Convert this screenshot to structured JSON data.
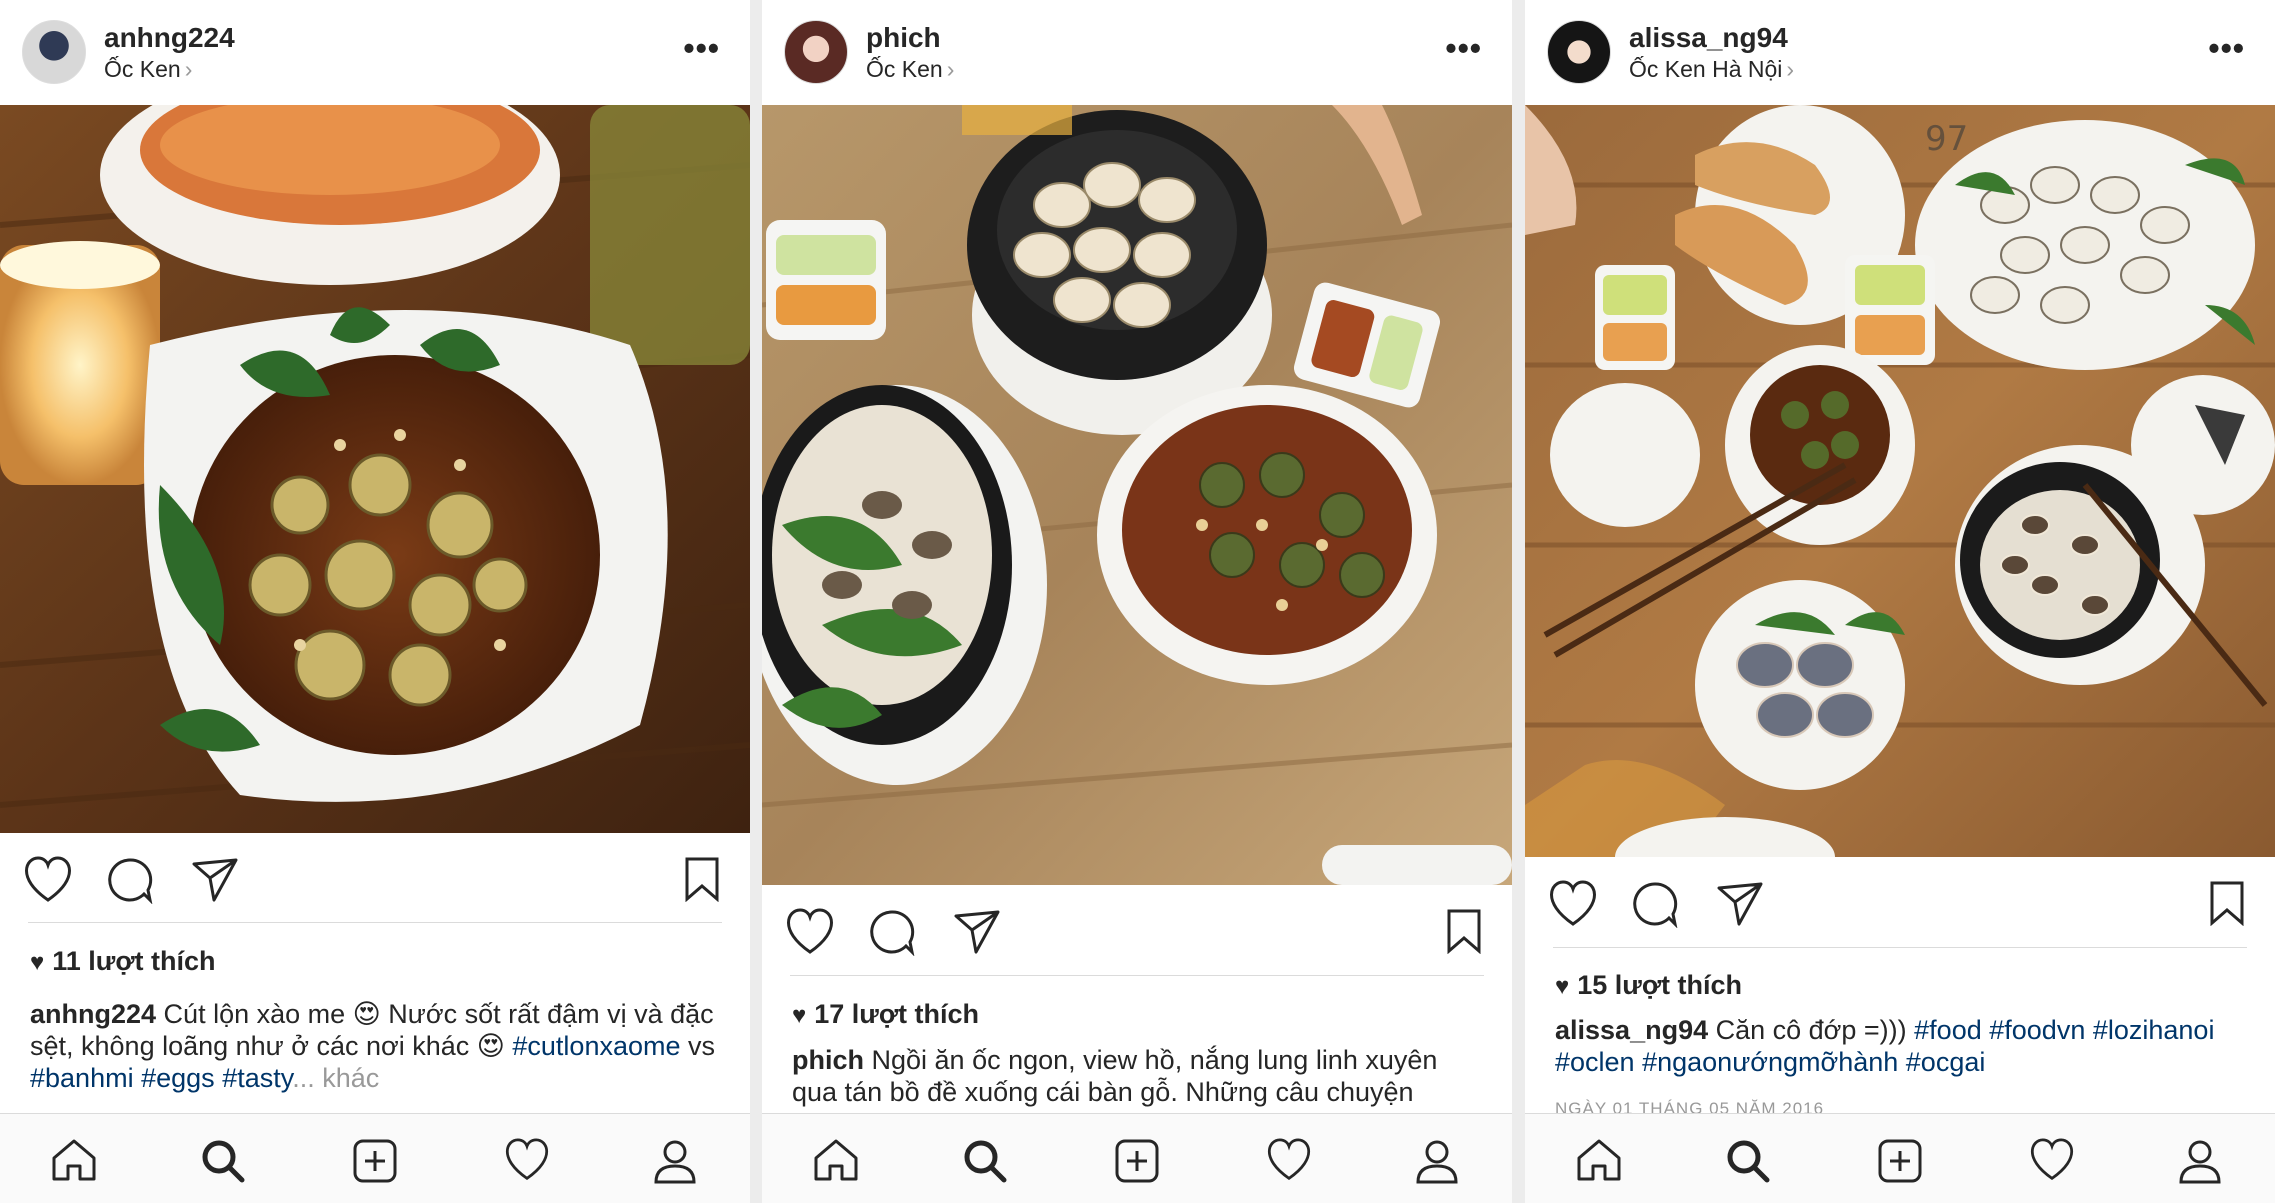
{
  "panels": [
    {
      "username": "anhng224",
      "location": "Ốc Ken",
      "likes": "11 lượt thích",
      "caption_user": "anhng224",
      "caption_text1": " Cút lộn xào me 😍  Nước sốt rất đậm vị và đặc sệt, không loãng như ở các nơi khác 😍 ",
      "tags": [
        "#cutlonxaome",
        "vs",
        "#banhmi",
        "#eggs",
        "#tasty"
      ],
      "more": "... khác"
    },
    {
      "username": "phich",
      "location": "Ốc Ken",
      "likes": "17 lượt thích",
      "caption_user": "phich",
      "caption_text1": " Ngồi ăn ốc ngon, view hồ, nắng lung linh xuyên qua tán bồ đề xuống cái bàn gỗ. Những câu chuyện"
    },
    {
      "username": "alissa_ng94",
      "location": "Ốc Ken Hà Nội",
      "likes": "15 lượt thích",
      "caption_user": "alissa_ng94",
      "caption_text1": " Căn cô đớp =))) ",
      "tags": [
        "#food",
        "#foodvn",
        "#lozihanoi",
        "#oclen",
        "#ngaonướngmỡhành",
        "#ocgai"
      ],
      "date": "NGÀY 01 THÁNG 05 NĂM 2016"
    }
  ],
  "icons": {
    "more": "more-icon",
    "heart": "heart-icon",
    "comment": "comment-icon",
    "share": "share-icon",
    "bookmark": "bookmark-icon",
    "home": "home-icon",
    "search": "search-icon",
    "add": "add-icon",
    "activity": "activity-icon",
    "profile": "profile-icon"
  },
  "more_glyph": "•••",
  "liked_heart_glyph": "♥",
  "location_chevron": "›"
}
